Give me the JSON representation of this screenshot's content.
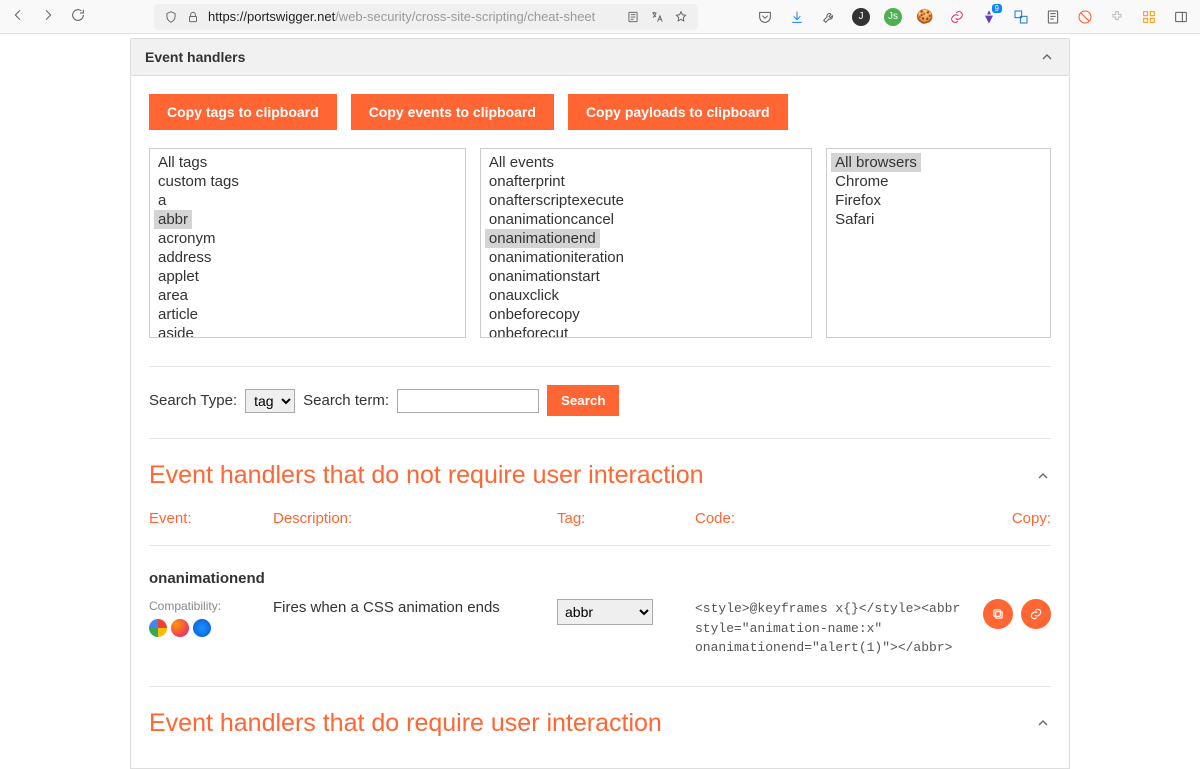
{
  "url": {
    "host": "https://portswigger.net",
    "path": "/web-security/cross-site-scripting/cheat-sheet"
  },
  "panel": {
    "title": "Event handlers"
  },
  "buttons": {
    "copyTags": "Copy tags to clipboard",
    "copyEvents": "Copy events to clipboard",
    "copyPayloads": "Copy payloads to clipboard"
  },
  "tags": [
    "All tags",
    "custom tags",
    "a",
    "abbr",
    "acronym",
    "address",
    "applet",
    "area",
    "article",
    "aside"
  ],
  "tagSelected": "abbr",
  "events": [
    "All events",
    "onafterprint",
    "onafterscriptexecute",
    "onanimationcancel",
    "onanimationend",
    "onanimationiteration",
    "onanimationstart",
    "onauxclick",
    "onbeforecopy",
    "onbeforecut"
  ],
  "eventSelected": "onanimationend",
  "browsers": [
    "All browsers",
    "Chrome",
    "Firefox",
    "Safari"
  ],
  "browserSelected": "All browsers",
  "search": {
    "typeLabel": "Search Type:",
    "typeValue": "tag",
    "termLabel": "Search term:",
    "button": "Search"
  },
  "section1": {
    "title": "Event handlers that do not require user interaction"
  },
  "cols": {
    "event": "Event:",
    "desc": "Description:",
    "tag": "Tag:",
    "code": "Code:",
    "copy": "Copy:"
  },
  "entry": {
    "name": "onanimationend",
    "compatLabel": "Compatibility:",
    "desc": "Fires when a CSS animation ends",
    "tag": "abbr",
    "code": "<style>@keyframes x{}</style><abbr style=\"animation-name:x\" onanimationend=\"alert(1)\"></abbr>"
  },
  "section2": {
    "title": "Event handlers that do require user interaction"
  }
}
